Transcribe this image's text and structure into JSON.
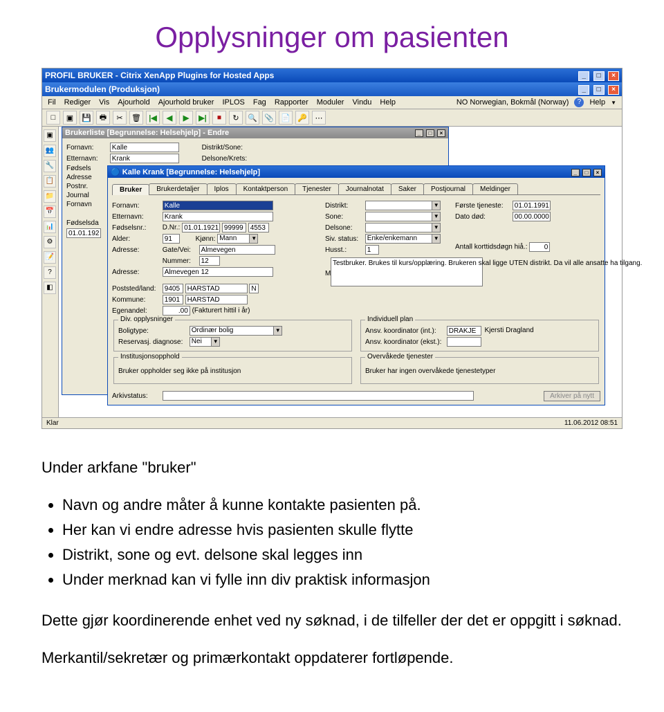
{
  "heading": "Opplysninger om pasienten",
  "app": {
    "outer_title": "PROFIL BRUKER - Citrix XenApp Plugins for Hosted Apps",
    "inner_title": "Brukermodulen (Produksjon)",
    "locale": "NO Norwegian, Bokmål (Norway)",
    "help": "Help",
    "menubar": [
      "Fil",
      "Rediger",
      "Vis",
      "Ajourhold",
      "Ajourhold bruker",
      "IPLOS",
      "Fag",
      "Rapporter",
      "Moduler",
      "Vindu",
      "Help"
    ]
  },
  "list_window": {
    "title": "Brukerliste  [Begrunnelse: Helsehjelp] - Endre",
    "labels": {
      "fornavn": "Fornavn:",
      "etternavn": "Etternavn:",
      "fodsels": "Fødsels",
      "adresse": "Adresse",
      "postnr": "Postnr.",
      "journal": "Journal",
      "fornavn2": "Fornavn",
      "distrikt_sone": "Distrikt/Sone:",
      "delsone_krets": "Delsone/Krets:",
      "fodselsda": "Fødselsda",
      "date": "01.01.192"
    },
    "values": {
      "fornavn": "Kalle",
      "etternavn": "Krank"
    }
  },
  "detail_window": {
    "title": "Kalle Krank  [Begrunnelse: Helsehjelp]",
    "tabs": [
      "Bruker",
      "Brukerdetaljer",
      "Iplos",
      "Kontaktperson",
      "Tjenester",
      "Journalnotat",
      "Saker",
      "Postjournal",
      "Meldinger"
    ],
    "labels": {
      "fornavn": "Fornavn:",
      "etternavn": "Etternavn:",
      "fodselsnr": "Fødselsnr.:",
      "dnr": "D.Nr.:",
      "alder": "Alder:",
      "kjonn": "Kjønn:",
      "adresse": "Adresse:",
      "gate": "Gate/Vei:",
      "nummer": "Nummer:",
      "poststed": "Poststed/land:",
      "kommune": "Kommune:",
      "egenandel": "Egenandel:",
      "distrikt": "Distrikt:",
      "sone": "Sone:",
      "delsone": "Delsone:",
      "sivstatus": "Siv. status:",
      "husst": "Husst.:",
      "merknad": "Merknad:",
      "forste_tjeneste": "Første tjeneste:",
      "dato_dod": "Dato død:",
      "antall_kort": "Antall korttidsdøgn hiå.:",
      "fakturert": "(Fakturert hittil i år)",
      "arkivstatus": "Arkivstatus:",
      "arkiver_btn": "Arkiver på nytt"
    },
    "values": {
      "fornavn": "Kalle",
      "etternavn": "Krank",
      "fodselsnr": "01.01.1921",
      "dnr1": "99999",
      "dnr2": "4553",
      "alder": "91",
      "kjonn": "Mann",
      "gate": "Almevegen",
      "nummer": "12",
      "adresse": "Almevegen 12",
      "post_nr": "9405",
      "post_sted": "HARSTAD",
      "post_land": "N",
      "kommune_nr": "1901",
      "kommune_navn": "HARSTAD",
      "egenandel": ".00",
      "sivstatus": "Enke/enkemann",
      "husst": "1",
      "forste_tjeneste": "01.01.1991",
      "dato_dod": "00.00.0000",
      "antall_kort": "0",
      "merknad": "Testbruker. Brukes til kurs/opplæring. Brukeren skal ligge UTEN distrikt. Da vil alle ansatte ha tilgang."
    },
    "div_opplysninger": {
      "legend": "Div. opplysninger",
      "boligtype_lbl": "Boligtype:",
      "boligtype": "Ordinær bolig",
      "reservasj_lbl": "Reservasj. diagnose:",
      "reservasj": "Nei"
    },
    "individuell_plan": {
      "legend": "Individuell plan",
      "int_lbl": "Ansv. koordinator (int.):",
      "int_code": "DRAKJE",
      "int_name": "Kjersti Dragland",
      "ekst_lbl": "Ansv. koordinator (ekst.):"
    },
    "institusjon": {
      "legend": "Institusjonsopphold",
      "text": "Bruker oppholder seg ikke på institusjon"
    },
    "overvakede": {
      "legend": "Overvåkede tjenester",
      "text": "Bruker har ingen overvåkede tjenestetyper"
    }
  },
  "statusbar": {
    "left": "Klar",
    "right": "11.06.2012 08:51"
  },
  "body": {
    "intro": "Under arkfane \"bruker\"",
    "bullets": [
      "Navn og andre måter å kunne kontakte pasienten på.",
      "Her kan vi endre adresse hvis pasienten skulle flytte",
      "Distrikt, sone og evt. delsone skal legges inn",
      "Under merknad kan vi fylle inn div praktisk informasjon"
    ],
    "para1": "Dette gjør koordinerende enhet ved ny søknad, i de tilfeller der det er oppgitt i søknad.",
    "para2": "Merkantil/sekretær og primærkontakt oppdaterer fortløpende."
  }
}
